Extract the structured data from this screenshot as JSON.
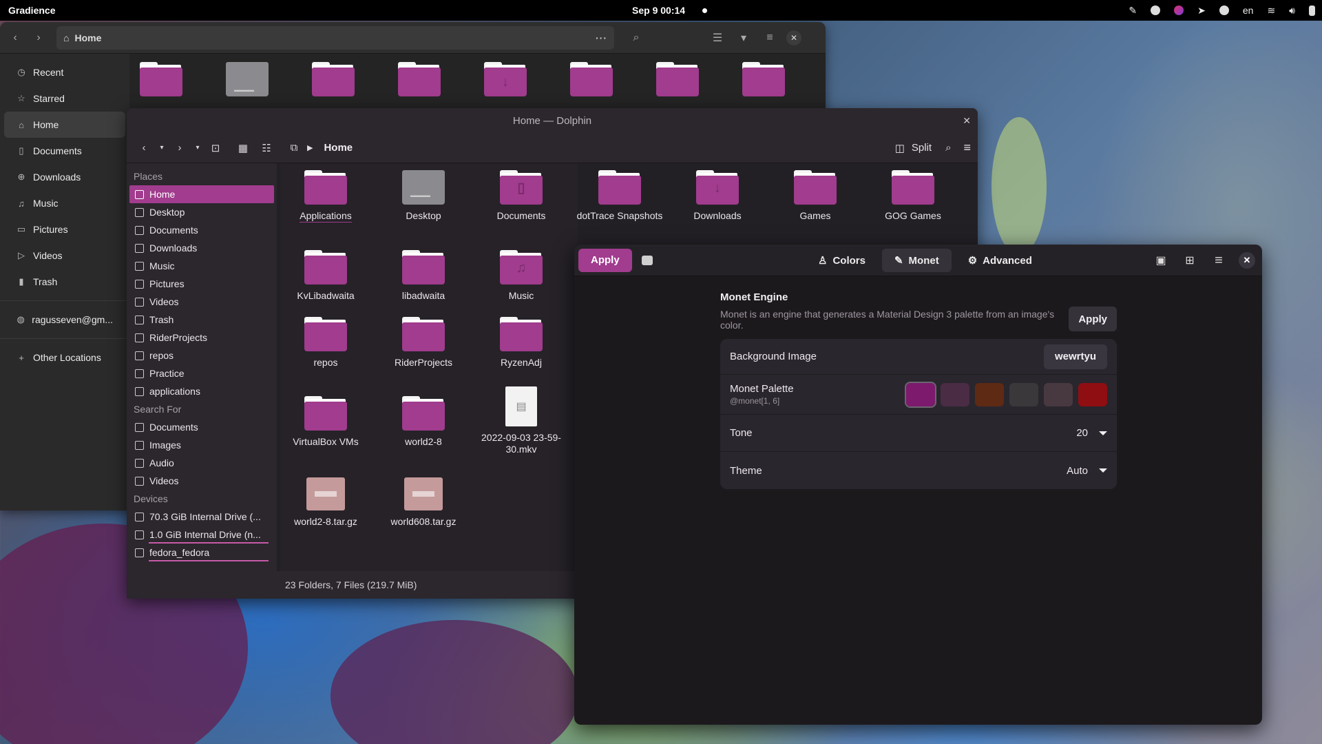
{
  "topbar": {
    "app_name": "Gradience",
    "clock": "Sep 9  00:14",
    "keyboard_layout": "en"
  },
  "nautilus": {
    "path": "Home",
    "sidebar": [
      {
        "label": "Recent",
        "icon": "clock-icon"
      },
      {
        "label": "Starred",
        "icon": "star-icon"
      },
      {
        "label": "Home",
        "icon": "home-icon",
        "active": true
      },
      {
        "label": "Documents",
        "icon": "document-icon"
      },
      {
        "label": "Downloads",
        "icon": "download-icon"
      },
      {
        "label": "Music",
        "icon": "music-icon"
      },
      {
        "label": "Pictures",
        "icon": "picture-icon"
      },
      {
        "label": "Videos",
        "icon": "video-icon"
      },
      {
        "label": "Trash",
        "icon": "trash-icon"
      },
      {
        "label": "ragusseven@gm...",
        "icon": "network-icon"
      },
      {
        "label": "Other Locations",
        "icon": "plus-icon"
      }
    ]
  },
  "dolphin": {
    "title": "Home — Dolphin",
    "breadcrumb": "Home",
    "split_label": "Split",
    "places_header": "Places",
    "places": [
      "Home",
      "Desktop",
      "Documents",
      "Downloads",
      "Music",
      "Pictures",
      "Videos",
      "Trash",
      "RiderProjects",
      "repos",
      "Practice",
      "applications"
    ],
    "search_header": "Search For",
    "search_items": [
      "Documents",
      "Images",
      "Audio",
      "Videos"
    ],
    "devices_header": "Devices",
    "devices": [
      "70.3 GiB Internal Drive (...",
      "1.0 GiB Internal Drive (n...",
      "fedora_fedora"
    ],
    "files": [
      {
        "label": "Applications",
        "kind": "folder"
      },
      {
        "label": "Desktop",
        "kind": "desktop"
      },
      {
        "label": "Documents",
        "kind": "folder",
        "glyph": "doc"
      },
      {
        "label": "dotTrace Snapshots",
        "kind": "folder"
      },
      {
        "label": "Downloads",
        "kind": "folder",
        "glyph": "down"
      },
      {
        "label": "Games",
        "kind": "folder"
      },
      {
        "label": "GOG Games",
        "kind": "folder"
      },
      {
        "label": "KvLibadwaita",
        "kind": "folder"
      },
      {
        "label": "libadwaita",
        "kind": "folder"
      },
      {
        "label": "Music",
        "kind": "folder",
        "glyph": "music"
      },
      {
        "label": "repos",
        "kind": "folder"
      },
      {
        "label": "RiderProjects",
        "kind": "folder"
      },
      {
        "label": "RyzenAdj",
        "kind": "folder"
      },
      {
        "label": "VirtualBox VMs",
        "kind": "folder"
      },
      {
        "label": "world2-8",
        "kind": "folder"
      },
      {
        "label": "2022-09-03 23-59-30.mkv",
        "kind": "video"
      },
      {
        "label": "world2-8.tar.gz",
        "kind": "archive"
      },
      {
        "label": "world608.tar.gz",
        "kind": "archive"
      }
    ],
    "status": "23 Folders, 7 Files (219.7 MiB)"
  },
  "gradience": {
    "apply_label": "Apply",
    "tabs": [
      {
        "label": "Colors",
        "icon": "palette-icon"
      },
      {
        "label": "Monet",
        "icon": "brush-icon",
        "active": true
      },
      {
        "label": "Advanced",
        "icon": "gear-icon"
      }
    ],
    "engine_title": "Monet Engine",
    "engine_desc": "Monet is an engine that generates a Material Design 3 palette from an image's color.",
    "engine_apply": "Apply",
    "bg_image_label": "Background Image",
    "bg_image_value": "wewrtyu",
    "palette_label": "Monet Palette",
    "palette_sub": "@monet[1, 6]",
    "palette_colors": [
      "#7d1a6e",
      "#4a2c45",
      "#5e2a14",
      "#3a383b",
      "#47393f",
      "#8e0e12"
    ],
    "tone_label": "Tone",
    "tone_value": "20",
    "theme_label": "Theme",
    "theme_value": "Auto"
  },
  "colors": {
    "accent": "#a13c8e"
  }
}
